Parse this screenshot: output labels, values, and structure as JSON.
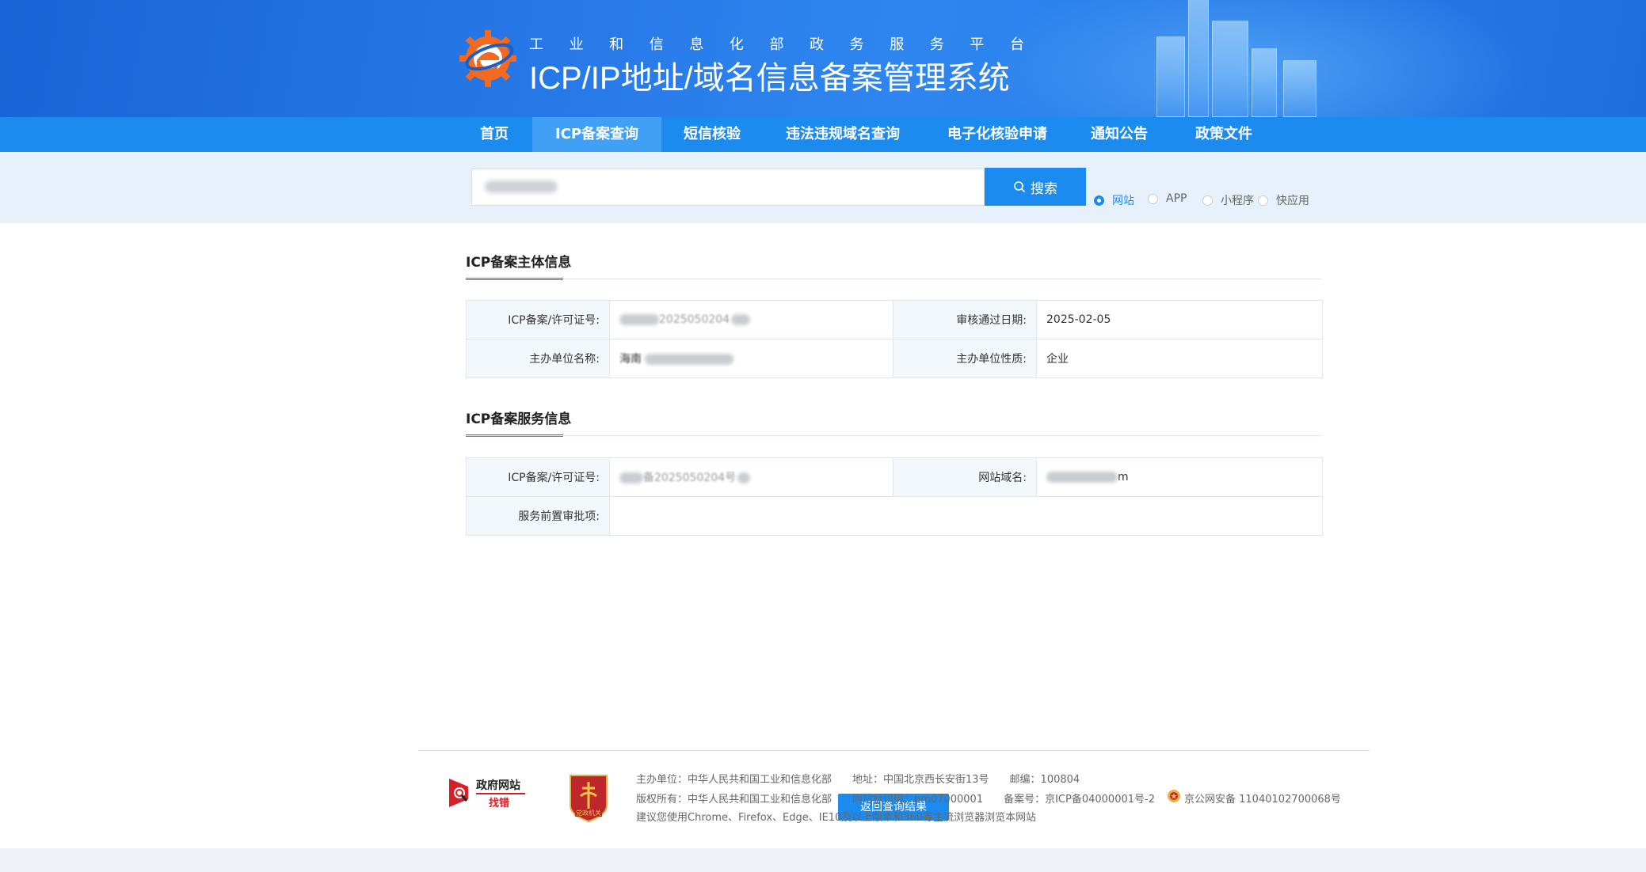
{
  "header": {
    "subtitle_chars": [
      "工",
      "业",
      "和",
      "信",
      "息",
      "化",
      "部",
      "政",
      "务",
      "服",
      "务",
      "平",
      "台"
    ],
    "title": "ICP/IP地址/域名信息备案管理系统"
  },
  "nav": {
    "items": [
      {
        "label": "首页"
      },
      {
        "label": "ICP备案查询"
      },
      {
        "label": "短信核验"
      },
      {
        "label": "违法违规域名查询"
      },
      {
        "label": "电子化核验申请"
      },
      {
        "label": "通知公告"
      },
      {
        "label": "政策文件"
      }
    ],
    "active_index": 1
  },
  "search": {
    "button_label": "搜索",
    "types": [
      "网站",
      "APP",
      "小程序",
      "快应用"
    ],
    "selected_type": "网站"
  },
  "subject_section": {
    "title": "ICP备案主体信息",
    "labels": {
      "license": "ICP备案/许可证号:",
      "approve_date": "审核通过日期:",
      "org_name": "主办单位名称:",
      "org_type": "主办单位性质:"
    },
    "values": {
      "license_visible": "2025050204",
      "approve_date": "2025-02-05",
      "org_name_visible": "海南",
      "org_type": "企业"
    }
  },
  "service_section": {
    "title": "ICP备案服务信息",
    "labels": {
      "license": "ICP备案/许可证号:",
      "domain": "网站域名:",
      "pre_approval": "服务前置审批项:"
    },
    "values": {
      "license_visible": "备2025050204号",
      "domain_visible": "m",
      "pre_approval": ""
    }
  },
  "actions": {
    "back_label": "返回查询结果"
  },
  "footer": {
    "gov_logo_top": "政府网站",
    "gov_logo_bottom": "找错",
    "party_badge": "党政机关",
    "line1": "主办单位：中华人民共和国工业和信息化部　　地址：中国北京西长安街13号　　邮编：100804",
    "line2": "版权所有：中华人民共和国工业和信息化部　　网站标识码：bm07000001　　备案号：京ICP备04000001号-2",
    "police": "京公网安备 11040102700068号",
    "line3": "建议您使用Chrome、Firefox、Edge、IE10及以上版本和360等主流浏览器浏览本网站"
  },
  "colors": {
    "primary": "#1b8bf0",
    "header_dark": "#1a63d8",
    "label_bg": "#f3f8fd"
  }
}
